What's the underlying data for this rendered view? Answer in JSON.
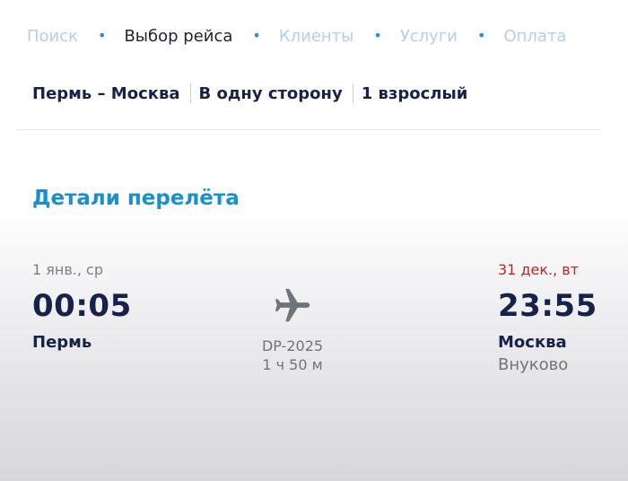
{
  "steps": [
    {
      "label": "Поиск",
      "state": "done"
    },
    {
      "label": "Выбор рейса",
      "state": "active"
    },
    {
      "label": "Клиенты",
      "state": "upcoming"
    },
    {
      "label": "Услуги",
      "state": "upcoming"
    },
    {
      "label": "Оплата",
      "state": "upcoming"
    }
  ],
  "summary": {
    "route": "Пермь – Москва",
    "trip_type": "В одну сторону",
    "passengers": "1 взрослый"
  },
  "details": {
    "title": "Детали перелёта",
    "departure": {
      "date": "1 янв., ср",
      "time": "00:05",
      "city": "Пермь"
    },
    "flight": {
      "number": "DP-2025",
      "duration": "1 ч 50 м",
      "icon": "airplane-icon"
    },
    "arrival": {
      "date": "31 дек., вт",
      "time": "23:55",
      "city": "Москва",
      "airport": "Внуково"
    }
  },
  "colors": {
    "accent": "#1a8fcd",
    "dot": "#2394cf",
    "inactive_step": "#b6cfe6",
    "text_dark": "#16224a",
    "warning": "#bf2328",
    "muted": "#6f747b"
  }
}
